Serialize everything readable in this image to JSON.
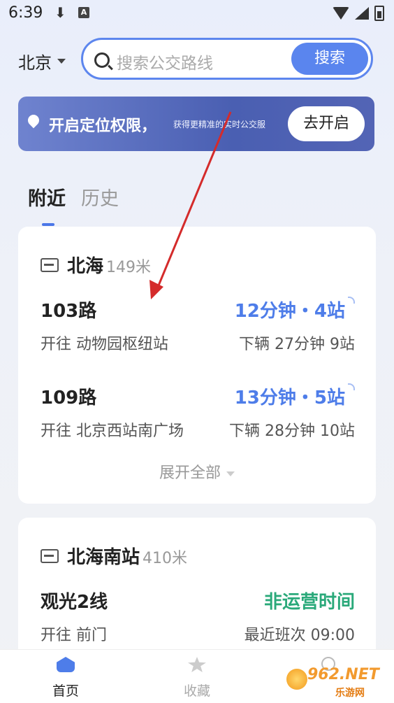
{
  "status_bar": {
    "time": "6:39",
    "download": "⬇",
    "a_badge": "A"
  },
  "header": {
    "city": "北京",
    "search_placeholder": "搜索公交路线",
    "search_button": "搜索"
  },
  "banner": {
    "title": "开启定位权限，",
    "subtitle": "获得更精准的实时公交服",
    "button": "去开启"
  },
  "tabs": [
    {
      "label": "附近"
    },
    {
      "label": "历史"
    }
  ],
  "stations": [
    {
      "name": "北海",
      "distance": "149米",
      "routes": [
        {
          "name": "103路",
          "eta": "12分钟・4站",
          "direction": "开往 动物园枢纽站",
          "next": "下辆 27分钟 9站"
        },
        {
          "name": "109路",
          "eta": "13分钟・5站",
          "direction": "开往 北京西站南广场",
          "next": "下辆 28分钟 10站"
        }
      ],
      "expand": "展开全部"
    },
    {
      "name": "北海南站",
      "distance": "410米",
      "routes": [
        {
          "name": "观光2线",
          "eta": "非运营时间",
          "direction": "开往 前门",
          "next": "最近班次 09:00"
        }
      ]
    }
  ],
  "bottom_nav": [
    {
      "label": "首页"
    },
    {
      "label": "收藏"
    }
  ],
  "watermark": {
    "text": "962.NET",
    "sub": "乐游网"
  },
  "colors": {
    "accent": "#5a85ee",
    "eta_blue": "#4e7de9",
    "eta_green": "#2aa97a",
    "annotation_red": "#d42b2b"
  }
}
